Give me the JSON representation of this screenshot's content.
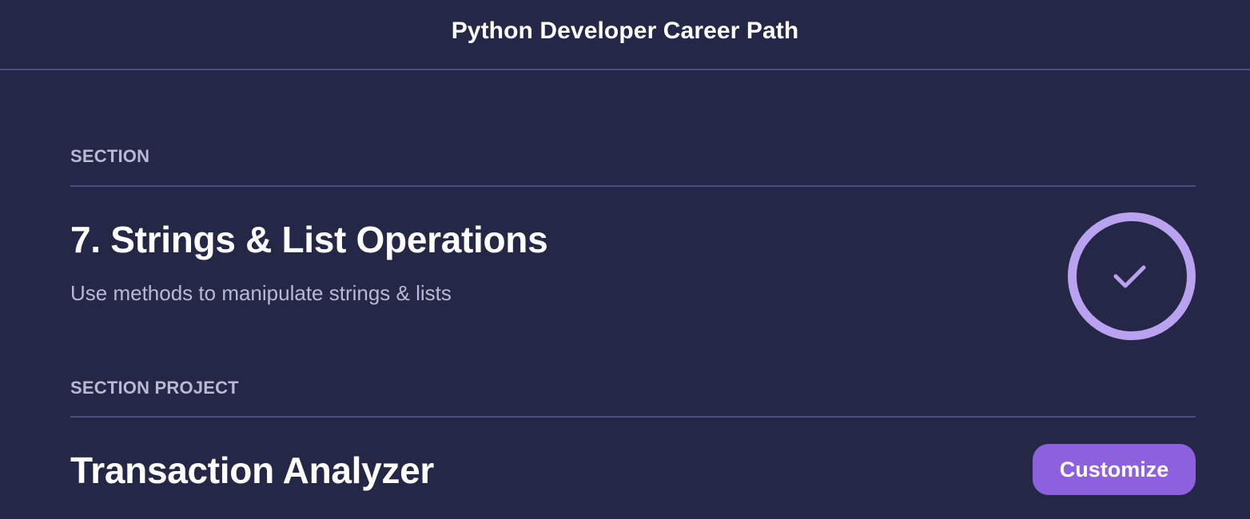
{
  "header": {
    "title": "Python Developer Career Path"
  },
  "section": {
    "eyebrow": "SECTION",
    "title": "7. Strings & List Operations",
    "description": "Use methods to manipulate strings & lists",
    "status_icon": "check-circle-icon",
    "status_color": "#b9a2ef"
  },
  "project": {
    "eyebrow": "SECTION PROJECT",
    "title": "Transaction Analyzer",
    "customize_label": "Customize"
  },
  "colors": {
    "background": "#252746",
    "divider": "#4d4e86",
    "muted_text": "#b9b8d6",
    "accent_button": "#8d61dd"
  }
}
